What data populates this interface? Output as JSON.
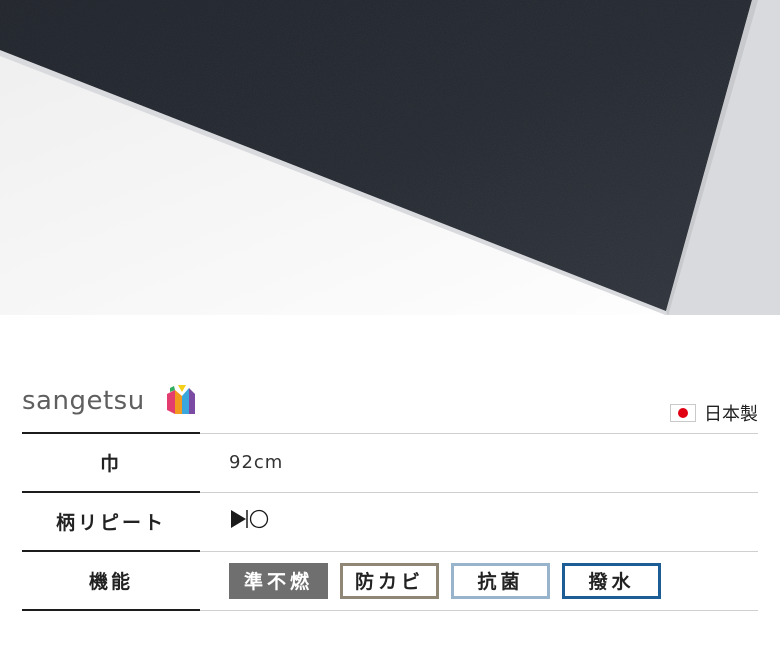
{
  "brand": {
    "name": "sangetsu",
    "logo_icon": "sangetsu-logo-icon"
  },
  "origin": {
    "flag_icon": "japan-flag-icon",
    "label": "日本製"
  },
  "specs": [
    {
      "label": "巾",
      "value": "92cm"
    },
    {
      "label": "柄リピート",
      "value_icon": "play-circle-icon"
    },
    {
      "label": "機能",
      "badges": [
        {
          "label": "準不燃",
          "color": "#6f6f6f"
        },
        {
          "label": "防カビ",
          "color": "#8f8675"
        },
        {
          "label": "抗菌",
          "color": "#98b3cc"
        },
        {
          "label": "撥水",
          "color": "#1d5d96"
        }
      ]
    }
  ]
}
